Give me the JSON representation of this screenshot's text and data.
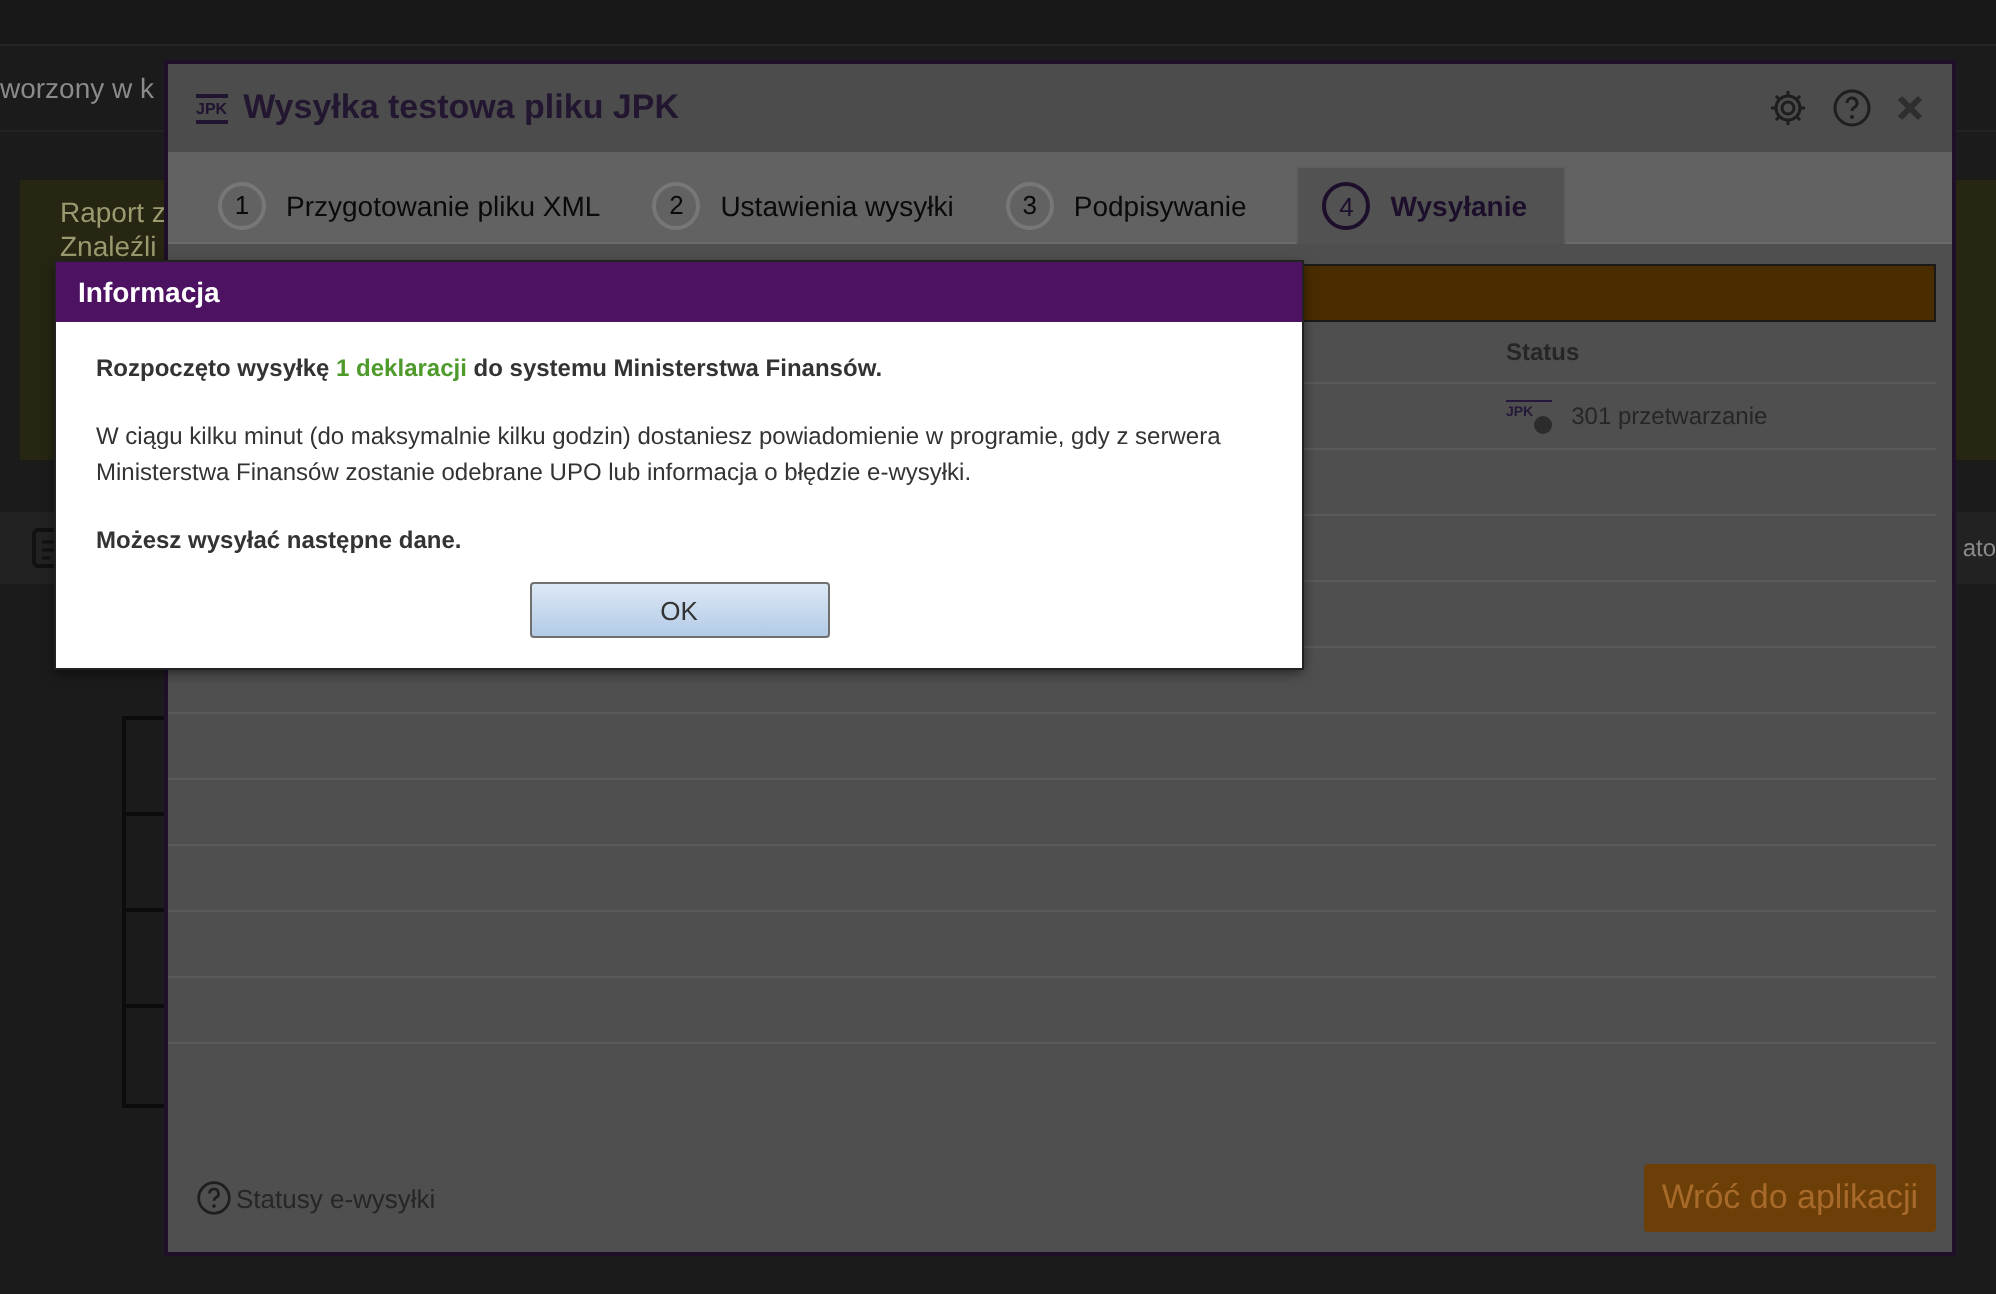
{
  "background_page": {
    "breadcrumb": "worzony w k",
    "notice_lines": [
      "Raport z",
      "Znaleźli"
    ],
    "toolbar_text": "ato"
  },
  "window": {
    "icon_text": "JPK",
    "title": "Wysyłka testowa pliku JPK",
    "tabs": [
      {
        "number": "1",
        "label": "Przygotowanie pliku XML",
        "selected": false
      },
      {
        "number": "2",
        "label": "Ustawienia wysyłki",
        "selected": false
      },
      {
        "number": "3",
        "label": "Podpisywanie",
        "selected": false
      },
      {
        "number": "4",
        "label": "Wysyłanie",
        "selected": true
      }
    ],
    "table": {
      "status_header": "Status",
      "rows": [
        {
          "icon_text": "JPK",
          "status": "301 przetwarzanie"
        }
      ]
    },
    "help_link": "Statusy e-wysyłki",
    "back_button": "Wróć do aplikacji"
  },
  "dialog": {
    "title": "Informacja",
    "paragraphs": [
      {
        "kind": "highlighted",
        "before": "Rozpoczęto wysyłkę ",
        "highlight": "1 deklaracji",
        "after": " do systemu Ministerstwa Finansów."
      },
      {
        "kind": "plain",
        "text": "W ciągu kilku minut (do maksymalnie kilku godzin) dostaniesz powiadomienie w programie, gdy z serwera Ministerstwa Finansów zostanie odebrane UPO lub informacja o błędzie e-wysyłki."
      },
      {
        "kind": "bold",
        "text": "Możesz wysyłać następne dane."
      }
    ],
    "button": "OK"
  }
}
